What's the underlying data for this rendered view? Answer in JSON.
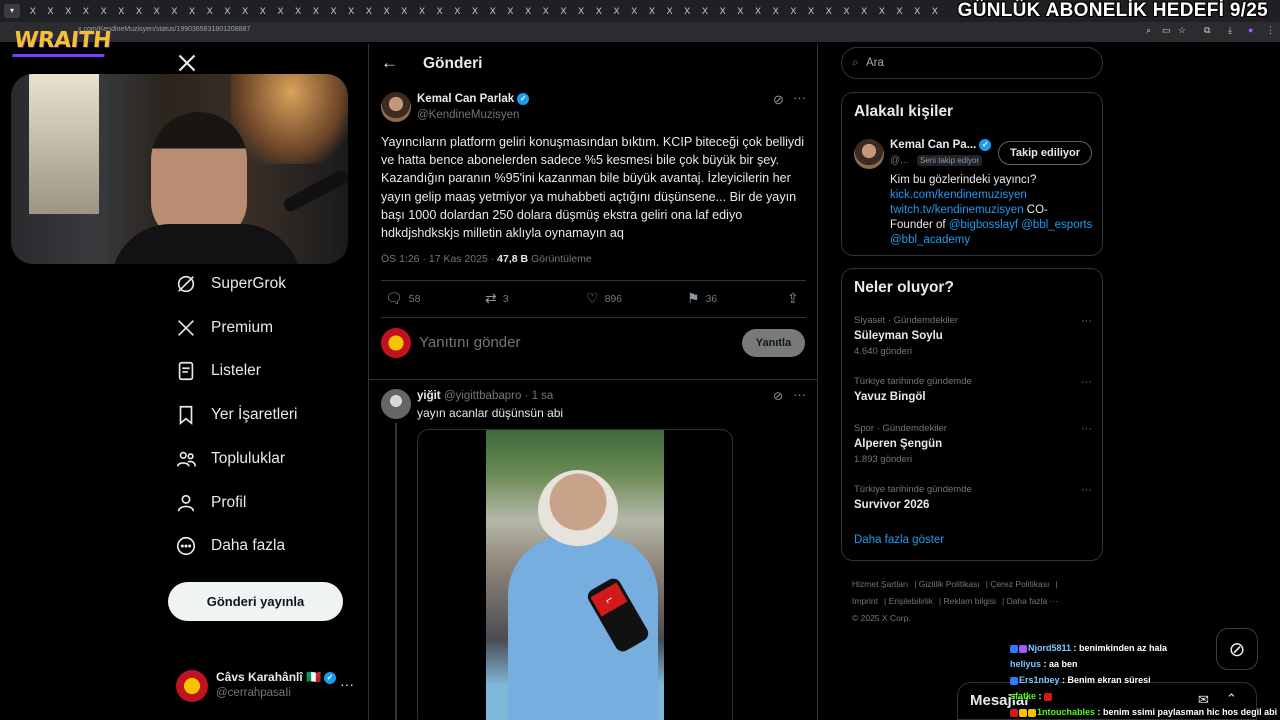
{
  "browser": {
    "tab_glyph": "X",
    "url": "x.com/KendineMuzisyen/status/1990365831801208887"
  },
  "overlay": {
    "goal_text": "GÜNLÜK ABONELİK HEDEFİ 9/25",
    "logo_text": "WRAITH"
  },
  "nav": {
    "items": [
      {
        "label": "SuperGrok",
        "icon": "grok-icon"
      },
      {
        "label": "Premium",
        "icon": "x-logo-icon"
      },
      {
        "label": "Listeler",
        "icon": "list-icon"
      },
      {
        "label": "Yer İşaretleri",
        "icon": "bookmark-icon"
      },
      {
        "label": "Topluluklar",
        "icon": "people-icon"
      },
      {
        "label": "Profil",
        "icon": "person-icon"
      },
      {
        "label": "Daha fazla",
        "icon": "more-circle-icon"
      }
    ],
    "post_button": "Gönderi yayınla",
    "account": {
      "name": "Câvs Karahânlî 🇮🇹",
      "handle": "@cerrahpasaIi"
    }
  },
  "main": {
    "header_title": "Gönderi",
    "tweet": {
      "author": "Kemal Can Parlak",
      "handle": "@KendineMuzisyen",
      "text": "Yayıncıların platform geliri konuşmasından bıktım. KCIP biteceği çok belliydi ve hatta bence abonelerden sadece %5 kesmesi bile çok büyük bir şey. Kazandığın paranın %95'ini kazanman bile büyük avantaj. İzleyicilerin her yayın gelip maaş yetmiyor ya muhabbeti açtığını düşünsene... Bir de yayın başı 1000 dolardan 250 dolara düşmüş ekstra geliri ona laf ediyo hdkdjshdkskjs milletin aklıyla oynamayın aq",
      "time": "ÖS 1:26 · 17 Kas 2025 · ",
      "views": "47,8 B",
      "views_label": " Görüntüleme",
      "replies": "58",
      "reposts": "3",
      "likes": "896",
      "bookmarks": "36"
    },
    "reply_placeholder": "Yanıtını gönder",
    "reply_button": "Yanıtla",
    "reply": {
      "name": "yiğit",
      "sub": "@yigittbabapro · 1 sa",
      "text": "yayın acanlar düşünsün abi"
    }
  },
  "sidebar": {
    "search_placeholder": "Ara",
    "people_title": "Alakalı kişiler",
    "person": {
      "name": "Kemal Can Pa...",
      "handle": "@...",
      "follows_you": "Seni takip ediyor",
      "follow_button": "Takip ediliyor",
      "bio_text": "Kim bu gözlerindeki yayıncı?",
      "bio_link1": "kick.com/kendinemuzisyen",
      "bio_link2": "twitch.tv/kendinemuzisyen",
      "bio_co": " CO-",
      "bio_founder": "Founder of ",
      "bio_link3": "@bigbosslayf",
      "bio_link4": "@bbl_esports",
      "bio_link5": "@bbl_academy"
    },
    "trends_title": "Neler oluyor?",
    "trends": [
      {
        "category": "Siyaset · Gündemdekiler",
        "topic": "Süleyman Soylu",
        "count": "4.640 gönderi"
      },
      {
        "category": "Türkiye tarihinde gündemde",
        "topic": "Yavuz Bingöl",
        "count": ""
      },
      {
        "category": "Spor · Gündemdekiler",
        "topic": "Alperen Şengün",
        "count": "1.893 gönderi"
      },
      {
        "category": "Türkiye tarihinde gündemde",
        "topic": "Survivor 2026",
        "count": ""
      }
    ],
    "show_more": "Daha fazla göster",
    "footer": {
      "l1": "Hizmet Şartları",
      "l2": "Gizlilik Politikası",
      "l3": "Çerez Politikası",
      "l4": "Imprint",
      "l5": "Erişilebilirlik",
      "l6": "Reklam bilgisi",
      "l7": "Daha fazla ···",
      "copy": "© 2025 X Corp."
    },
    "messages_label": "Mesajlar"
  },
  "chat": [
    {
      "user": "Njord5811",
      "msg": ": benimkinden az hala"
    },
    {
      "user": "heliyus",
      "msg": ": aa ben"
    },
    {
      "user": "Ers1nbey",
      "msg": ": Benim ekran süresi"
    },
    {
      "user": "sfatke",
      "msg": ":"
    },
    {
      "user": "1ntouchables",
      "msg": ": benim ssimi paylasman hic hos degil abi"
    }
  ]
}
